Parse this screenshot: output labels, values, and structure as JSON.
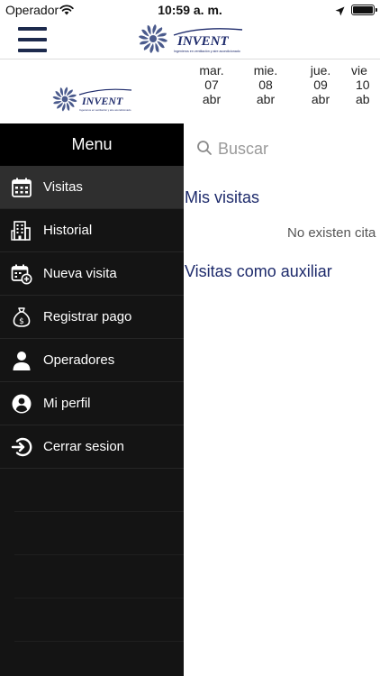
{
  "status": {
    "carrier": "Operador",
    "time": "10:59 a. m."
  },
  "brand": {
    "name": "INVENT",
    "tagline": "Ingenieros en ventilación y aire acondicionado",
    "color": "#1d2a6b",
    "accent": "#4a5a8c"
  },
  "calendar": {
    "days": [
      {
        "weekday": "mar.",
        "day": "07",
        "month": "abr"
      },
      {
        "weekday": "mie.",
        "day": "08",
        "month": "abr"
      },
      {
        "weekday": "jue.",
        "day": "09",
        "month": "abr"
      },
      {
        "weekday": "vie",
        "day": "10",
        "month": "ab"
      }
    ]
  },
  "search": {
    "placeholder": "Buscar",
    "value": ""
  },
  "content": {
    "my_visits_title": "Mis visitas",
    "empty_message": "No existen cita",
    "aux_visits_title": "Visitas como auxiliar"
  },
  "menu": {
    "title": "Menu",
    "items": [
      {
        "label": "Visitas",
        "icon": "calendar-icon",
        "active": true
      },
      {
        "label": "Historial",
        "icon": "building-icon",
        "active": false
      },
      {
        "label": "Nueva visita",
        "icon": "calendar-add-icon",
        "active": false
      },
      {
        "label": "Registrar pago",
        "icon": "money-bag-icon",
        "active": false
      },
      {
        "label": "Operadores",
        "icon": "person-icon",
        "active": false
      },
      {
        "label": "Mi perfil",
        "icon": "profile-icon",
        "active": false
      },
      {
        "label": "Cerrar sesion",
        "icon": "logout-icon",
        "active": false
      }
    ]
  }
}
